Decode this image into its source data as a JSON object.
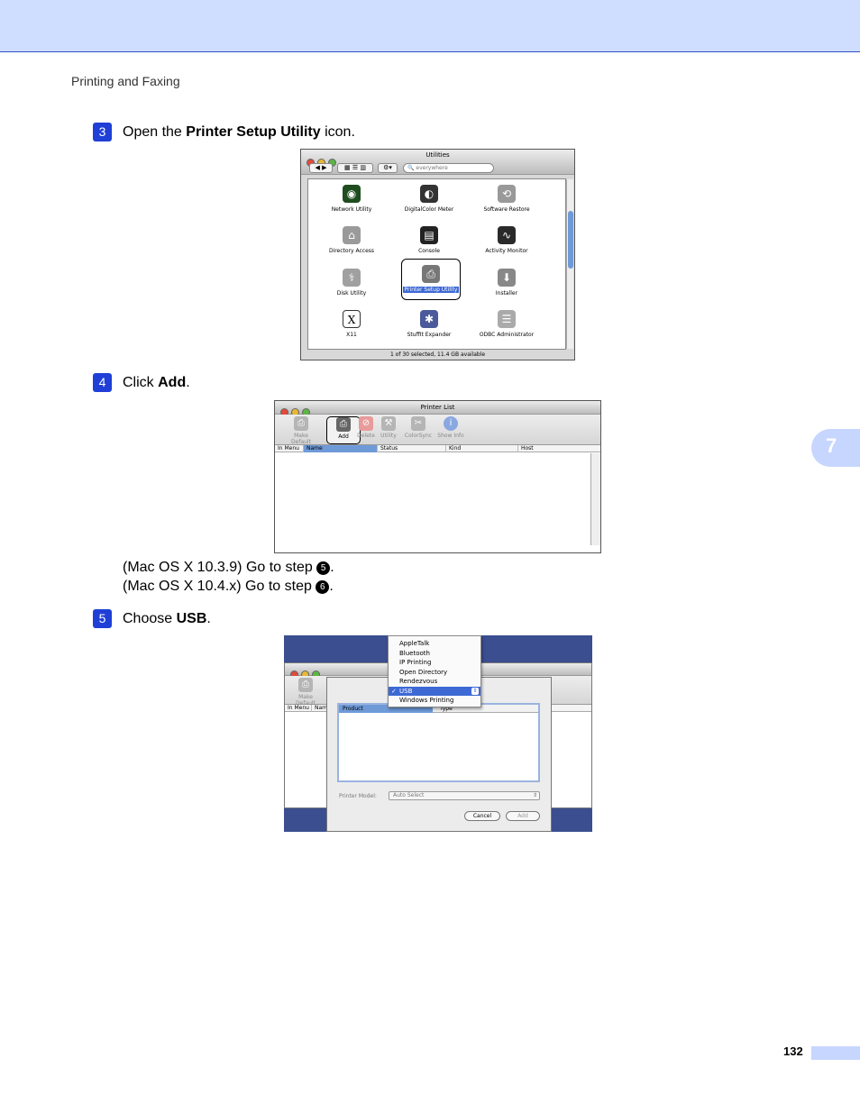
{
  "header": {
    "running_title": "Printing and Faxing"
  },
  "chapter_tab": "7",
  "steps": [
    {
      "number": "3",
      "pre": "Open the ",
      "bold": "Printer Setup Utility",
      "post": " icon."
    },
    {
      "number": "4",
      "pre": "Click ",
      "bold": "Add",
      "post": "."
    },
    {
      "number": "5",
      "pre": "Choose ",
      "bold": "USB",
      "post": "."
    }
  ],
  "notes": [
    {
      "pre": "(Mac OS X 10.3.9) Go to step ",
      "ref": "5",
      "post": "."
    },
    {
      "pre": "(Mac OS X 10.4.x) Go to step ",
      "ref": "6",
      "post": "."
    }
  ],
  "shot1": {
    "window_title": "Utilities",
    "search_placeholder": "everywhere",
    "apps": [
      "Network Utility",
      "DigitalColor Meter",
      "Software Restore",
      "Directory Access",
      "Console",
      "Activity Monitor",
      "Disk Utility",
      "Printer Setup Utility",
      "Installer",
      "X11",
      "StuffIt Expander",
      "ODBC Administrator"
    ],
    "status": "1 of 30 selected, 11.4 GB available"
  },
  "shot2": {
    "window_title": "Printer List",
    "tools": [
      "Make Default",
      "Add",
      "Delete",
      "Utility",
      "ColorSync",
      "Show Info"
    ],
    "columns": [
      "In Menu",
      "Name",
      "Status",
      "Kind",
      "Host"
    ]
  },
  "shot3": {
    "menu_items": [
      "AppleTalk",
      "Bluetooth",
      "IP Printing",
      "Open Directory",
      "Rendezvous",
      "USB",
      "Windows Printing"
    ],
    "selected_item": "USB",
    "bg_tool": "Make Default",
    "bg_columns": [
      "In Menu",
      "Nam"
    ],
    "list_columns": [
      "Product",
      "Type"
    ],
    "printer_model_label": "Printer Model:",
    "printer_model_value": "Auto Select",
    "cancel_label": "Cancel",
    "add_label": "Add"
  },
  "footer": {
    "page_number": "132"
  }
}
